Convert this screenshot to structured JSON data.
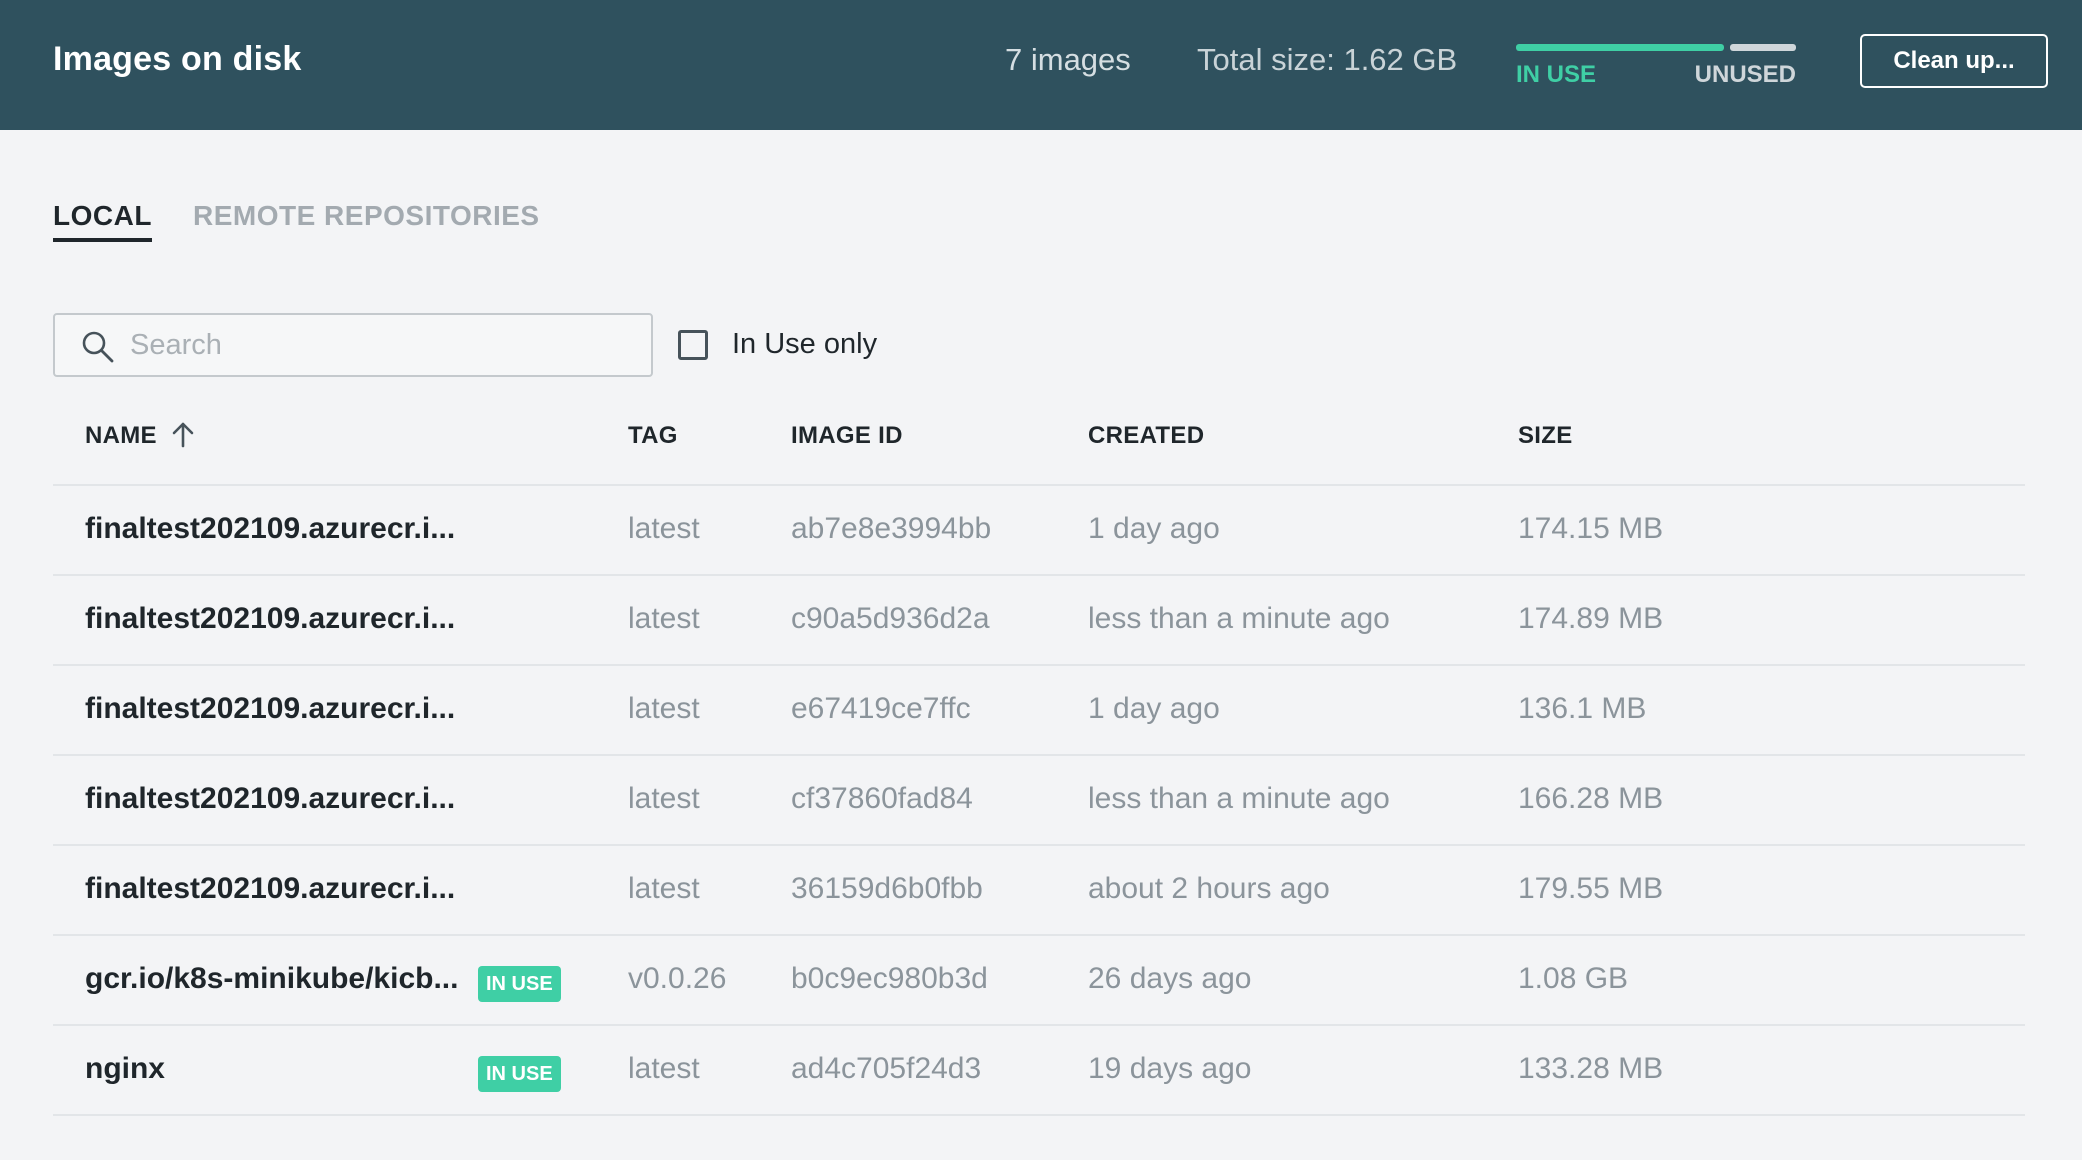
{
  "header": {
    "title": "Images on disk",
    "count": "7 images",
    "total_size": "Total size: 1.62 GB",
    "usage": {
      "in_use_label": "IN USE",
      "unused_label": "UNUSED",
      "in_use_fraction": 0.76,
      "in_use_color": "#3fcfa5",
      "unused_color": "#cfd6da"
    },
    "cleanup_label": "Clean up..."
  },
  "tabs": [
    {
      "label": "LOCAL",
      "active": true
    },
    {
      "label": "REMOTE REPOSITORIES",
      "active": false
    }
  ],
  "filters": {
    "search_placeholder": "Search",
    "search_icon": "search-icon",
    "in_use_only_label": "In Use only",
    "in_use_only_checked": false
  },
  "table": {
    "columns": {
      "name": "NAME",
      "tag": "TAG",
      "image_id": "IMAGE ID",
      "created": "CREATED",
      "size": "SIZE"
    },
    "sort_icon": "arrow-up-icon",
    "badge_label": "IN USE",
    "rows": [
      {
        "name": "finaltest202109.azurecr.i...",
        "in_use": false,
        "tag": "latest",
        "image_id": "ab7e8e3994bb",
        "created": "1 day ago",
        "size": "174.15 MB"
      },
      {
        "name": "finaltest202109.azurecr.i...",
        "in_use": false,
        "tag": "latest",
        "image_id": "c90a5d936d2a",
        "created": "less than a minute ago",
        "size": "174.89 MB"
      },
      {
        "name": "finaltest202109.azurecr.i...",
        "in_use": false,
        "tag": "latest",
        "image_id": "e67419ce7ffc",
        "created": "1 day ago",
        "size": "136.1 MB"
      },
      {
        "name": "finaltest202109.azurecr.i...",
        "in_use": false,
        "tag": "latest",
        "image_id": "cf37860fad84",
        "created": "less than a minute ago",
        "size": "166.28 MB"
      },
      {
        "name": "finaltest202109.azurecr.i...",
        "in_use": false,
        "tag": "latest",
        "image_id": "36159d6b0fbb",
        "created": "about 2 hours ago",
        "size": "179.55 MB"
      },
      {
        "name": "gcr.io/k8s-minikube/kicb...",
        "in_use": true,
        "tag": "v0.0.26",
        "image_id": "b0c9ec980b3d",
        "created": "26 days ago",
        "size": "1.08 GB"
      },
      {
        "name": "nginx",
        "in_use": true,
        "tag": "latest",
        "image_id": "ad4c705f24d3",
        "created": "19 days ago",
        "size": "133.28 MB"
      }
    ]
  }
}
